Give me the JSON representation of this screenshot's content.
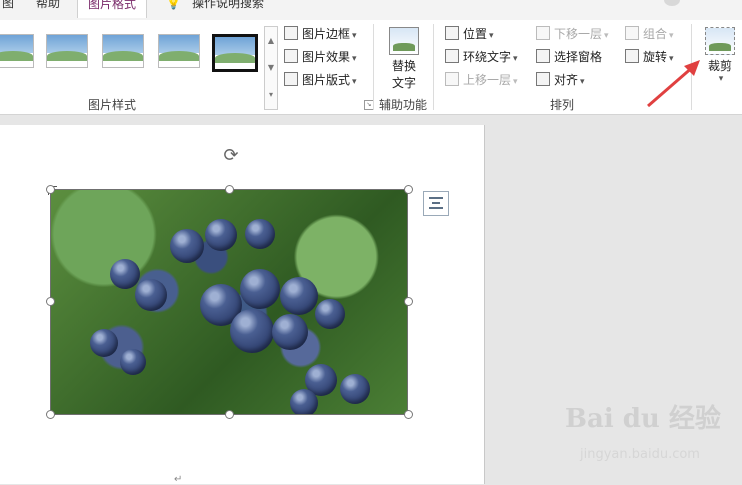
{
  "tabs": [
    {
      "label": "图"
    },
    {
      "label": "帮助"
    },
    {
      "label": "图片格式"
    },
    {
      "label": "操作说明搜索"
    }
  ],
  "ribbon": {
    "picture_styles": {
      "group_label": "图片样式",
      "commands": [
        {
          "label": "图片边框",
          "icon": "pen-border-icon"
        },
        {
          "label": "图片效果",
          "icon": "picture-effects-icon"
        },
        {
          "label": "图片版式",
          "icon": "picture-layout-icon"
        }
      ]
    },
    "accessibility": {
      "group_label": "辅助功能",
      "alt_text_line1": "替换",
      "alt_text_line2": "文字"
    },
    "arrange": {
      "group_label": "排列",
      "position": "位置",
      "wrap_text": "环绕文字",
      "bring_forward": "上移一层",
      "send_backward": "下移一层",
      "selection_pane": "选择窗格",
      "align": "对齐",
      "group": "组合",
      "rotate": "旋转"
    },
    "size": {
      "crop": "裁剪"
    }
  },
  "watermark": {
    "brand": "Bai du 经验",
    "url": "jingyan.baidu.com"
  },
  "colors": {
    "active_tab": "#7a2a6a",
    "arrow": "#e04040"
  }
}
